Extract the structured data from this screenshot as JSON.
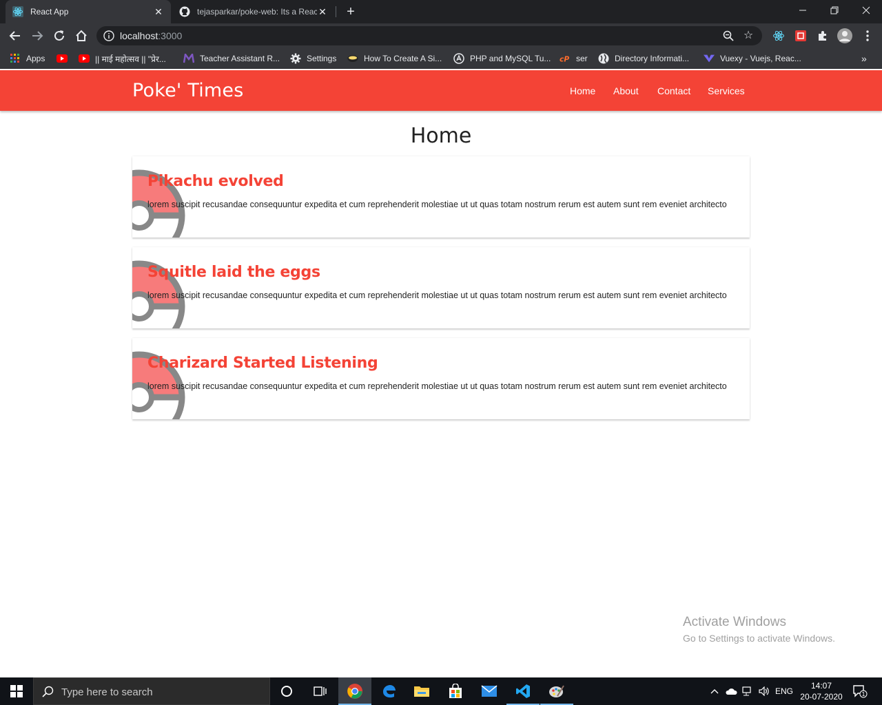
{
  "browser": {
    "tabs": [
      {
        "title": "React App",
        "active": true
      },
      {
        "title": "tejasparkar/poke-web: Its a React",
        "active": false
      }
    ],
    "url": {
      "host": "localhost",
      "port": ":3000"
    },
    "bookmarks": [
      {
        "label": "Apps",
        "icon": "apps-grid-icon"
      },
      {
        "label": "",
        "icon": "youtube-icon"
      },
      {
        "label": "|| माई महोत्सव || \"प्रेर...",
        "icon": "youtube-icon"
      },
      {
        "label": "Teacher Assistant R...",
        "icon": "m-logo-icon"
      },
      {
        "label": "Settings",
        "icon": "gear-icon"
      },
      {
        "label": "How To Create A Si...",
        "icon": "site-icon"
      },
      {
        "label": "PHP and MySQL Tu...",
        "icon": "site-icon"
      },
      {
        "label": "ser",
        "icon": "cpanel-icon"
      },
      {
        "label": "Directory Informati...",
        "icon": "globe-icon"
      },
      {
        "label": "Vuexy - Vuejs, Reac...",
        "icon": "vuexy-icon"
      }
    ]
  },
  "app": {
    "brand": "Poke' Times",
    "nav": [
      "Home",
      "About",
      "Contact",
      "Services"
    ],
    "page_title": "Home",
    "posts": [
      {
        "title": "Pikachu evolved",
        "body": "lorem suscipit recusandae consequuntur expedita et cum reprehenderit molestiae ut ut quas totam nostrum rerum est autem sunt rem eveniet architecto"
      },
      {
        "title": "Squitle laid the eggs",
        "body": "lorem suscipit recusandae consequuntur expedita et cum reprehenderit molestiae ut ut quas totam nostrum rerum est autem sunt rem eveniet architecto"
      },
      {
        "title": "Charizard Started Listening",
        "body": "lorem suscipit recusandae consequuntur expedita et cum reprehenderit molestiae ut ut quas totam nostrum rerum est autem sunt rem eveniet architecto"
      }
    ],
    "accent_color": "#f44336"
  },
  "watermark": {
    "line1": "Activate Windows",
    "line2": "Go to Settings to activate Windows."
  },
  "taskbar": {
    "search_placeholder": "Type here to search",
    "lang": "ENG",
    "time": "14:07",
    "date": "20-07-2020",
    "notification_count": "1"
  }
}
